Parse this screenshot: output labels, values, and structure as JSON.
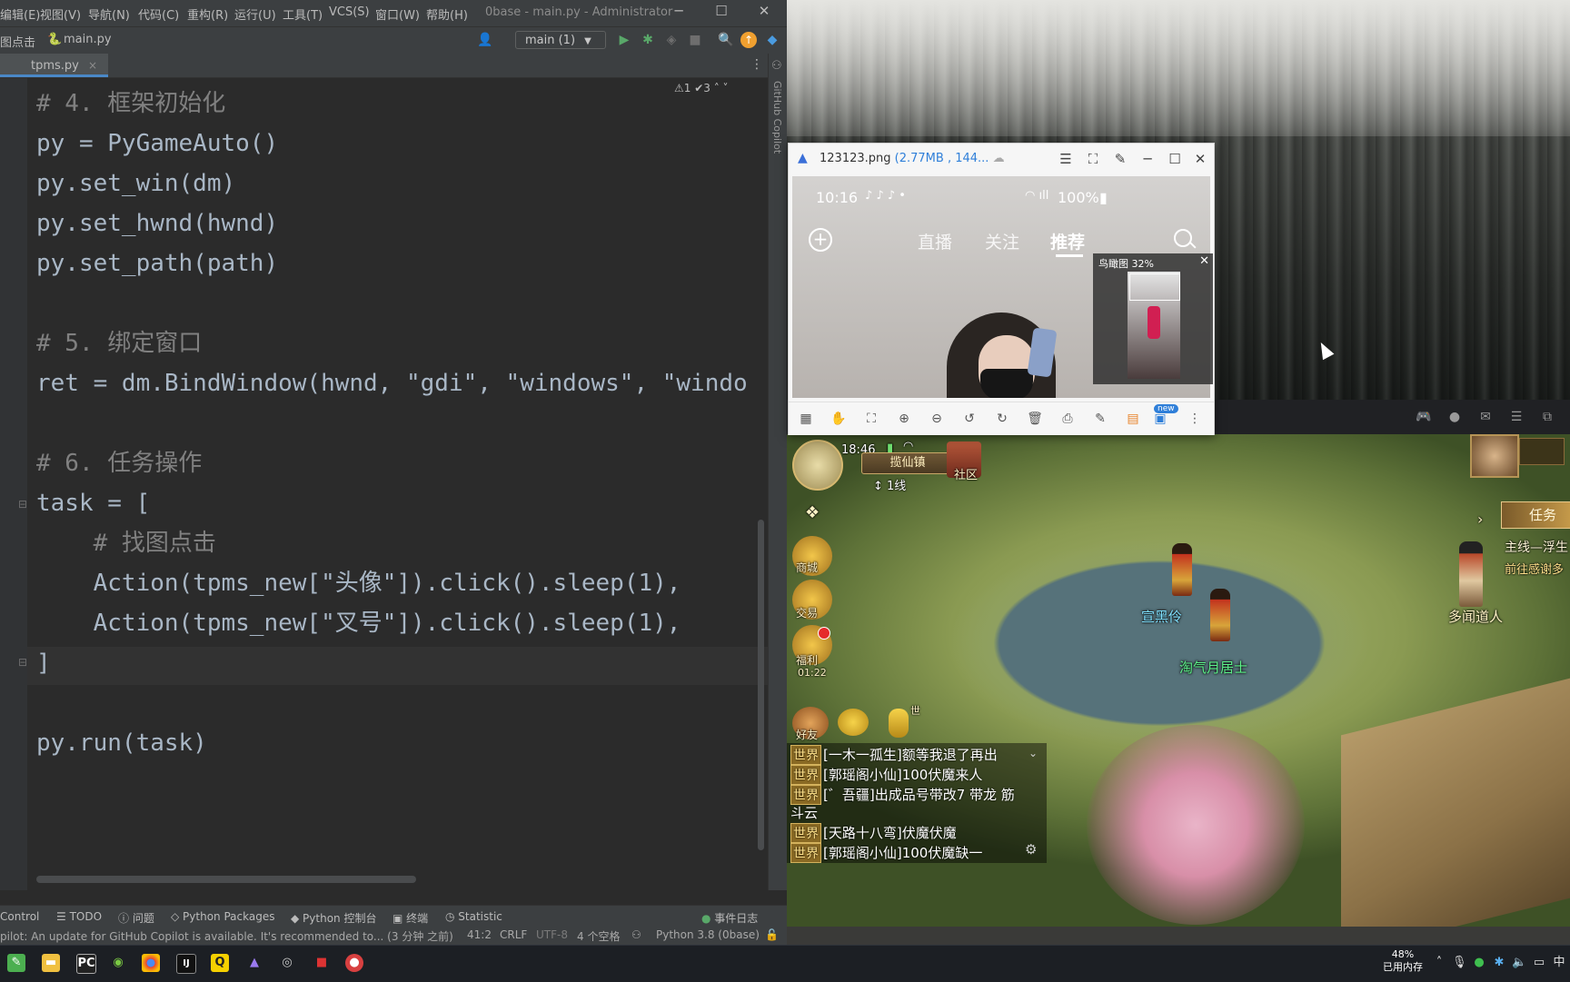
{
  "ide": {
    "menus": [
      "编辑(E)",
      "视图(V)",
      "导航(N)",
      "代码(C)",
      "重构(R)",
      "运行(U)",
      "工具(T)",
      "VCS(S)",
      "窗口(W)",
      "帮助(H)"
    ],
    "window_title": "0base - main.py - Administrator",
    "window_buttons": {
      "minimize": "─",
      "maximize": "☐",
      "close": "✕"
    },
    "breadcrumb": {
      "folder": "图点击",
      "file": "main.py"
    },
    "run_config": "main (1)",
    "tab": {
      "label": "tpms.py",
      "close": "×"
    },
    "inspections": "⚠1  ✔3  ˄  ˅",
    "copilot_label": "GitHub Copilot",
    "code_lines": [
      {
        "text": "# 4. 框架初始化"
      },
      {
        "text": "py = PyGameAuto()"
      },
      {
        "text": "py.set_win(dm)"
      },
      {
        "text": "py.set_hwnd(hwnd)"
      },
      {
        "text": "py.set_path(path)"
      },
      {
        "text": ""
      },
      {
        "text": "# 5. 绑定窗口"
      },
      {
        "text": "ret = dm.BindWindow(hwnd, \"gdi\", \"windows\", \"windo"
      },
      {
        "text": ""
      },
      {
        "text": "# 6. 任务操作"
      },
      {
        "text": "task = ["
      },
      {
        "text": "    # 找图点击"
      },
      {
        "text": "    Action(tpms_new[\"头像\"]).click().sleep(1),"
      },
      {
        "text": "    Action(tpms_new[\"叉号\"]).click().sleep(1),"
      },
      {
        "text": "]"
      },
      {
        "text": ""
      },
      {
        "text": "py.run(task)"
      }
    ],
    "tool_windows": [
      "Control",
      "TODO",
      "问题",
      "Python Packages",
      "Python 控制台",
      "终端",
      "Statistic",
      "事件日志"
    ],
    "status": {
      "message": "pilot: An update for GitHub Copilot is available. It's recommended to... (3 分钟 之前)",
      "position": "41:2",
      "line_sep": "CRLF",
      "encoding": "UTF-8",
      "indent": "4 个空格",
      "interpreter": "Python 3.8 (0base)"
    }
  },
  "viewer": {
    "title": "123123.png",
    "meta": "(2.77MB , 144...",
    "buttons": [
      "☰",
      "⛶",
      "✎",
      "─",
      "☐",
      "✕"
    ],
    "phone": {
      "time": "10:16",
      "battery": "100%",
      "tabs": [
        "直播",
        "关注",
        "推荐"
      ],
      "active_tab": "推荐"
    },
    "birdseye": {
      "label": "鸟瞰图 32%",
      "close": "✕"
    },
    "new_badge": "new",
    "toolbar_icons": [
      "grid",
      "hand",
      "crop",
      "zoom-in",
      "zoom-out",
      "rotate-left",
      "rotate-right",
      "delete",
      "print",
      "edit",
      "apps",
      "more"
    ]
  },
  "game": {
    "time": "18:46",
    "location": "揽仙镇",
    "line": "1线",
    "community": "社区",
    "side_buttons": [
      "商城",
      "交易",
      "福利"
    ],
    "welfare_timer": "01:22",
    "friend": "好友",
    "mic_tag": "世",
    "task_button": "任务",
    "quest_title": "主线—浮生",
    "quest_desc": "前往感谢多",
    "npcs": [
      "宣黑伶",
      "淘气月居士",
      "多闻道人"
    ],
    "chat": [
      {
        "tag": "世界",
        "text": "[一木一孤生]额等我退了再出"
      },
      {
        "tag": "世界",
        "text": "[郭瑶阁小仙]100伏魔来人"
      },
      {
        "tag": "世界",
        "text": "[゛吾疆]出成品号带改7 带龙 筋"
      },
      {
        "tag": "",
        "text": "斗云"
      },
      {
        "tag": "世界",
        "text": "[天路十八弯]伏魔伏魔"
      },
      {
        "tag": "世界",
        "text": "[郭瑶阁小仙]100伏魔缺一"
      }
    ]
  },
  "taskbar": {
    "memory_pct": "48%",
    "memory_label": "已用内存"
  }
}
